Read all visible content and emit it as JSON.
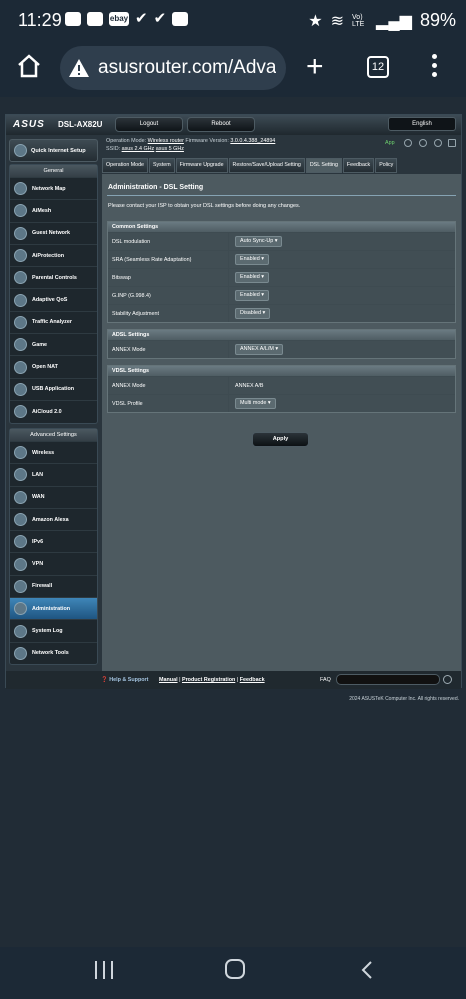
{
  "status_bar": {
    "time": "11:29",
    "battery": "89%",
    "signal_text": "Vo) LTE"
  },
  "browser": {
    "url": "asusrouter.com/Adva",
    "tab_count": "12"
  },
  "router": {
    "logo": "ASUS",
    "model": "DSL-AX82U",
    "logout_label": "Logout",
    "reboot_label": "Reboot",
    "language": "English",
    "op_mode_label": "Operation Mode:",
    "op_mode_value": "Wireless router",
    "fw_label": "Firmware Version:",
    "fw_value": "3.0.0.4.388_24894",
    "ssid_label": "SSID:",
    "ssid_1": "asus 2.4 GHz",
    "ssid_2": "asus 5 GHz",
    "app_label": "App",
    "quick_setup": "Quick Internet Setup",
    "general_header": "General",
    "general_items": [
      "Network Map",
      "AiMesh",
      "Guest Network",
      "AiProtection",
      "Parental Controls",
      "Adaptive QoS",
      "Traffic Analyzer",
      "Game",
      "Open NAT",
      "USB Application",
      "AiCloud 2.0"
    ],
    "advanced_header": "Advanced Settings",
    "advanced_items": [
      "Wireless",
      "LAN",
      "WAN",
      "Amazon Alexa",
      "IPv6",
      "VPN",
      "Firewall",
      "Administration",
      "System Log",
      "Network Tools"
    ],
    "tabs": [
      "Operation Mode",
      "System",
      "Firmware Upgrade",
      "Restore/Save/Upload Setting",
      "DSL Setting",
      "Feedback",
      "Policy"
    ],
    "page_title": "Administration - DSL Setting",
    "description": "Please contact your ISP to obtain your DSL settings before doing any changes.",
    "common_header": "Common Settings",
    "common_rows": [
      {
        "label": "DSL modulation",
        "value": "Auto Sync-Up"
      },
      {
        "label": "SRA (Seamless Rate Adaptation)",
        "value": "Enabled"
      },
      {
        "label": "Bitswap",
        "value": "Enabled"
      },
      {
        "label": "G.INP (G.998.4)",
        "value": "Enabled"
      },
      {
        "label": "Stability Adjustment",
        "value": "Disabled"
      }
    ],
    "adsl_header": "ADSL Settings",
    "adsl_rows": [
      {
        "label": "ANNEX Mode",
        "value": "ANNEX A/L/M"
      }
    ],
    "vdsl_header": "VDSL Settings",
    "vdsl_rows": [
      {
        "label": "ANNEX Mode",
        "value": "ANNEX A/B"
      },
      {
        "label": "VDSL Profile",
        "value": "Multi mode"
      }
    ],
    "apply_label": "Apply",
    "footer_help": "Help & Support",
    "footer_manual": "Manual",
    "footer_registration": "Product Registration",
    "footer_feedback": "Feedback",
    "footer_faq": "FAQ",
    "copyright": "2024 ASUSTeK Computer Inc. All rights reserved."
  }
}
